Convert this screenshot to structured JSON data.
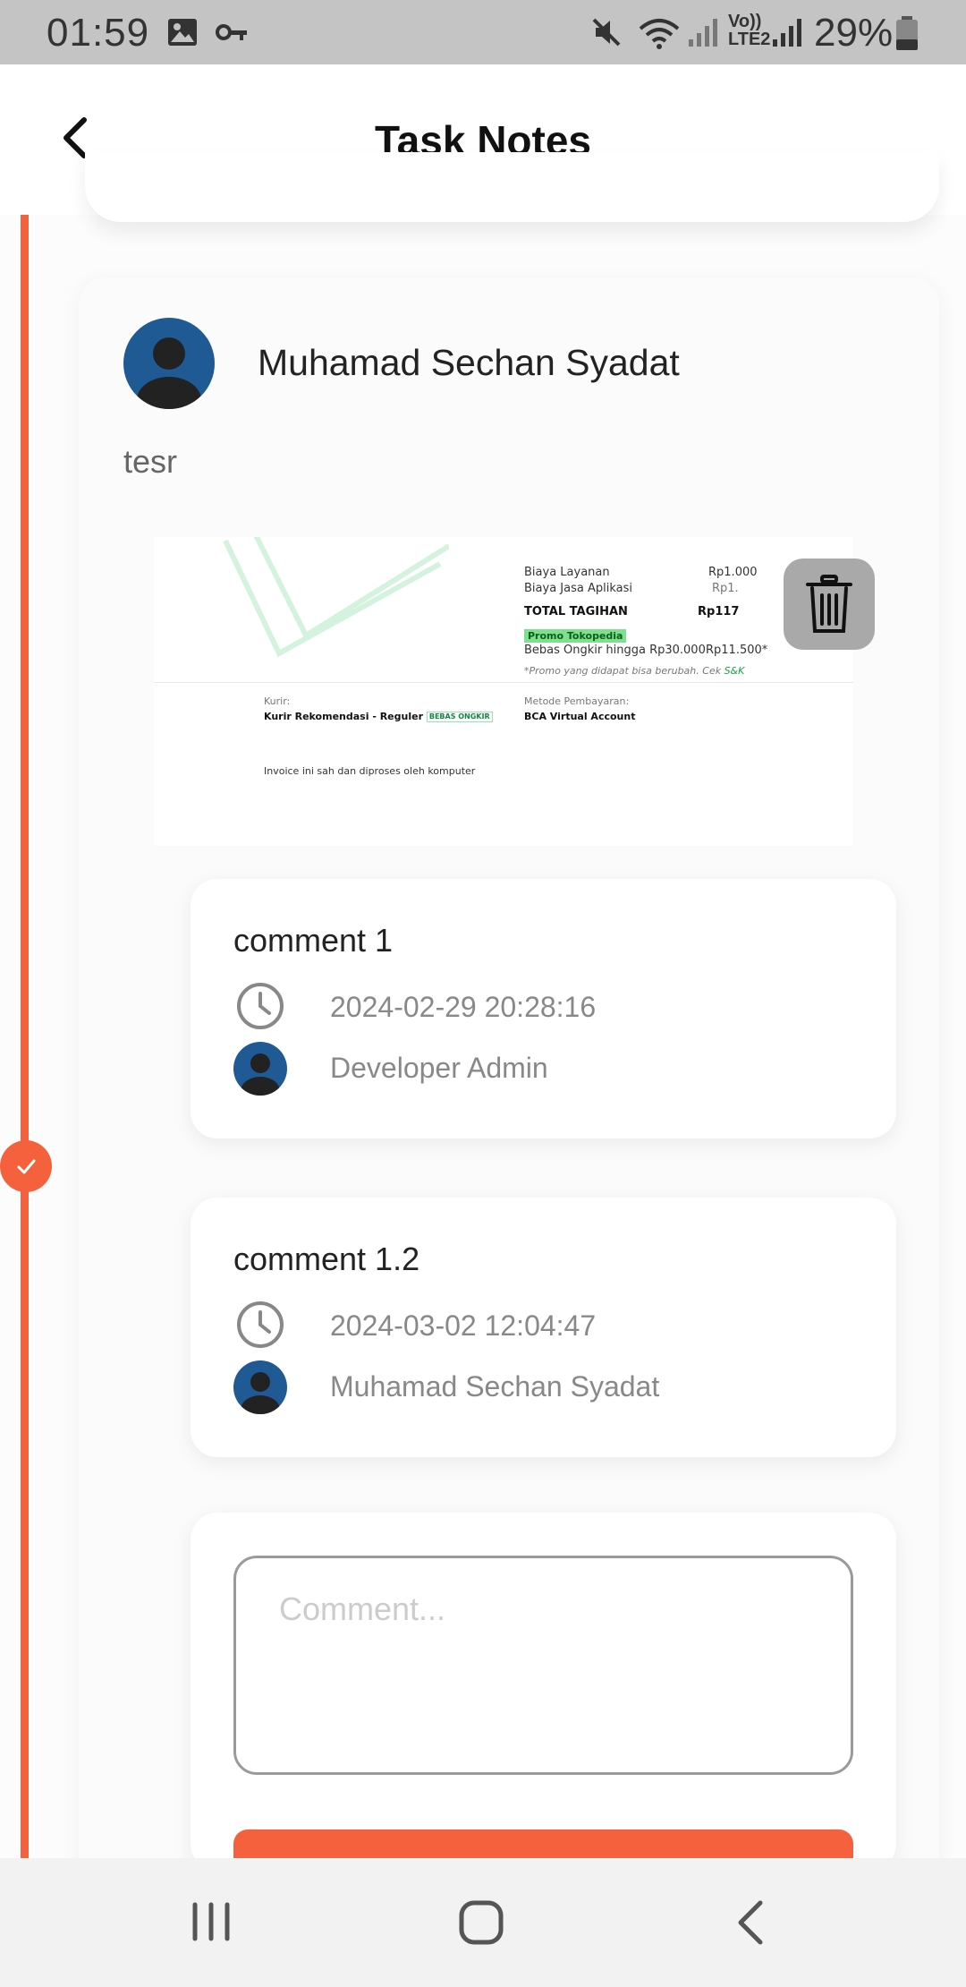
{
  "status_bar": {
    "time": "01:59",
    "battery": "29%",
    "icons": [
      "image-icon",
      "key-icon",
      "mute-icon",
      "wifi-icon",
      "signal-icon",
      "volte-icon",
      "signal-icon",
      "battery-icon"
    ]
  },
  "app_bar": {
    "title": "Task Notes",
    "back_icon": "chevron-left-icon"
  },
  "note": {
    "author": "Muhamad Sechan Syadat",
    "text": "tesr",
    "attachment": {
      "biaya_layanan_label": "Biaya Layanan",
      "biaya_layanan_value": "Rp1.000",
      "biaya_jasa_label": "Biaya Jasa Aplikasi",
      "biaya_jasa_value": "Rp1.",
      "total_label": "TOTAL TAGIHAN",
      "total_value": "Rp117",
      "promo_label": "Promo Tokopedia",
      "bebas_ongkir_label": "Bebas Ongkir hingga Rp30.000",
      "bebas_ongkir_value": "Rp11.500*",
      "promo_note": "*Promo yang didapat bisa berubah. Cek ",
      "promo_link": "S&K",
      "kurir_label": "Kurir:",
      "kurir_value": "Kurir Rekomendasi - Reguler",
      "kurir_badge": "BEBAS ONGKIR",
      "metode_label": "Metode Pembayaran:",
      "metode_value": "BCA Virtual Account",
      "footer": "Invoice ini sah dan diproses oleh komputer"
    }
  },
  "comments": [
    {
      "text": "comment 1",
      "time": "2024-02-29 20:28:16",
      "author": "Developer Admin"
    },
    {
      "text": "comment 1.2",
      "time": "2024-03-02 12:04:47",
      "author": "Muhamad Sechan Syadat"
    }
  ],
  "comment_input": {
    "placeholder": "Comment...",
    "value": ""
  },
  "colors": {
    "accent": "#f4613c",
    "avatar": "#1f5a94",
    "status_bar": "#c4c4c4"
  }
}
